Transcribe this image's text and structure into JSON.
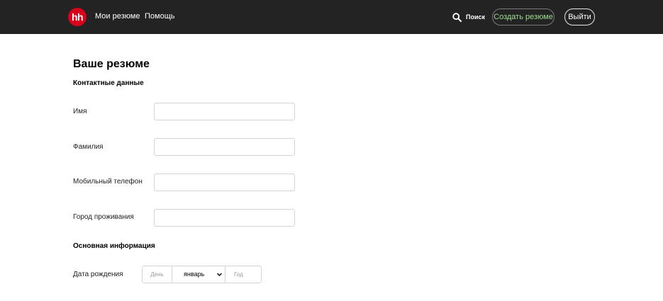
{
  "header": {
    "logo_text": "hh",
    "nav": {
      "my_resumes": "Мои резюме",
      "help": "Помощь"
    },
    "search_label": "Поиск",
    "search_icon": "search-icon",
    "create_resume": "Создать резюме",
    "logout": "Выйти",
    "colors": {
      "background": "#232323",
      "logo": "#d6001c",
      "create_text": "#9fdc90"
    }
  },
  "form": {
    "title": "Ваше резюме",
    "contacts_title": "Контактные данные",
    "fields": {
      "first_name": {
        "label": "Имя",
        "value": ""
      },
      "last_name": {
        "label": "Фамилия",
        "value": ""
      },
      "phone": {
        "label": "Мобильный телефон",
        "value": ""
      },
      "city": {
        "label": "Город проживания",
        "value": ""
      }
    },
    "basic_title": "Основная информация",
    "birth_date": {
      "label": "Дата рождения",
      "day_placeholder": "День",
      "month_value": "январь",
      "year_placeholder": "Год"
    }
  }
}
